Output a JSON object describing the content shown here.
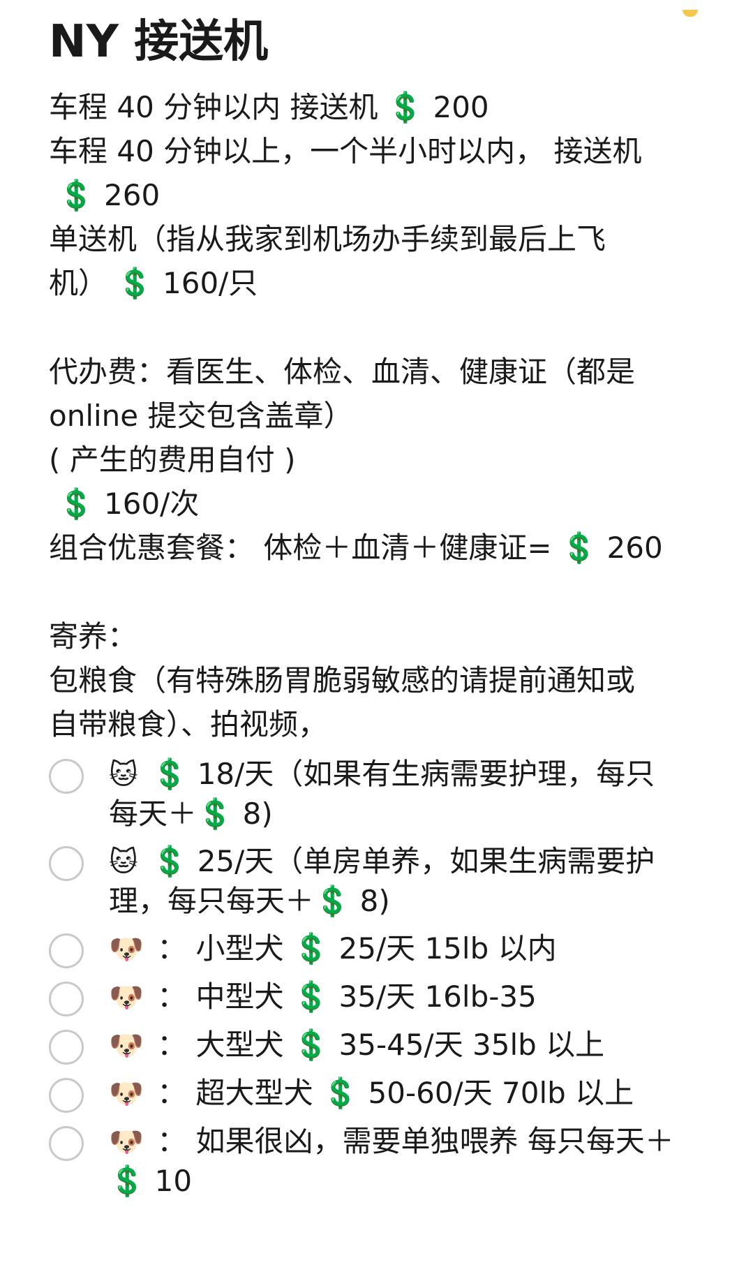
{
  "title": "NY 接送机",
  "transfer": {
    "line1": "车程 40 分钟以内 接送机 💲 200",
    "line2": "车程 40 分钟以上，一个半小时以内， 接送机",
    "line3": " 💲 260",
    "line4": "单送机（指从我家到机场办手续到最后上飞",
    "line5": "机） 💲 160/只"
  },
  "agency": {
    "line1": "代办费：看医生、体检、血清、健康证（都是",
    "line2": "online 提交包含盖章）",
    "line3": "( 产生的费用自付 )",
    "line4": " 💲 160/次",
    "line5": "组合优惠套餐： 体检＋血清＋健康证= 💲 260"
  },
  "boarding": {
    "label": "寄养：",
    "desc1": "包粮食（有特殊肠胃脆弱敏感的请提前通知或",
    "desc2": "自带粮食）、拍视频，",
    "items": [
      {
        "emoji": "🐱",
        "text": "💲 18/天（如果有生病需要护理，每只每天＋💲 8)"
      },
      {
        "emoji": "🐱",
        "text": "💲 25/天（单房单养，如果生病需要护理，每只每天＋💲 8)"
      },
      {
        "emoji": "🐶",
        "text": "： 小型犬 💲 25/天 15lb 以内"
      },
      {
        "emoji": "🐶",
        "text": "： 中型犬 💲 35/天 16lb-35"
      },
      {
        "emoji": "🐶",
        "text": "： 大型犬 💲 35-45/天 35lb 以上"
      },
      {
        "emoji": "🐶",
        "text": "： 超大型犬 💲 50-60/天 70lb 以上"
      },
      {
        "emoji": "🐶",
        "text": "： 如果很凶，需要单独喂养 每只每天＋💲 10"
      }
    ]
  }
}
